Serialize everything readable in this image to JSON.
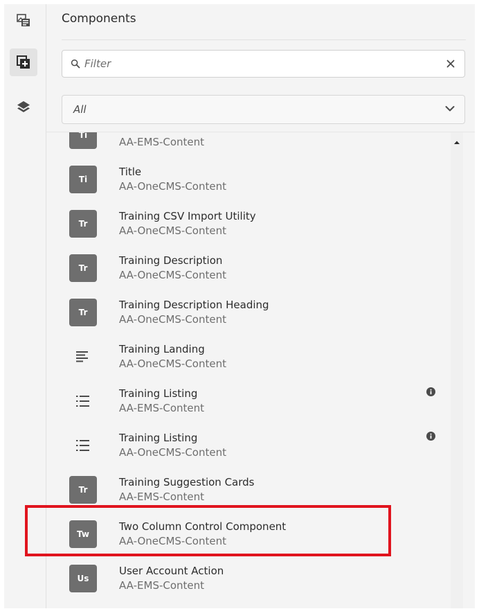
{
  "panel": {
    "title": "Components"
  },
  "filter": {
    "placeholder": "Filter",
    "value": ""
  },
  "group_select": {
    "value": "All"
  },
  "rail": {
    "buttons": [
      {
        "icon": "asset-finder-icon",
        "active": false
      },
      {
        "icon": "components-icon",
        "active": true
      },
      {
        "icon": "layers-icon",
        "active": false
      }
    ]
  },
  "components": [
    {
      "badge": "Ti",
      "name": "",
      "group": "AA-EMS-Content",
      "icon": "badge"
    },
    {
      "badge": "Ti",
      "name": "Title",
      "group": "AA-OneCMS-Content",
      "icon": "badge"
    },
    {
      "badge": "Tr",
      "name": "Training CSV Import Utility",
      "group": "AA-OneCMS-Content",
      "icon": "badge"
    },
    {
      "badge": "Tr",
      "name": "Training Description",
      "group": "AA-OneCMS-Content",
      "icon": "badge"
    },
    {
      "badge": "Tr",
      "name": "Training Description Heading",
      "group": "AA-OneCMS-Content",
      "icon": "badge"
    },
    {
      "badge": "",
      "name": "Training Landing",
      "group": "AA-OneCMS-Content",
      "icon": "text-align-icon"
    },
    {
      "badge": "",
      "name": "Training Listing",
      "group": "AA-EMS-Content",
      "icon": "bulleted-list-icon",
      "info": true
    },
    {
      "badge": "",
      "name": "Training Listing",
      "group": "AA-OneCMS-Content",
      "icon": "bulleted-list-icon",
      "info": true
    },
    {
      "badge": "Tr",
      "name": "Training Suggestion Cards",
      "group": "AA-EMS-Content",
      "icon": "badge"
    },
    {
      "badge": "Tw",
      "name": "Two Column Control Component",
      "group": "AA-OneCMS-Content",
      "icon": "badge",
      "highlighted": true
    },
    {
      "badge": "Us",
      "name": "User Account Action",
      "group": "AA-EMS-Content",
      "icon": "badge"
    }
  ],
  "colors": {
    "badge_bg": "#6e6e6e",
    "highlight": "#e0141e",
    "panel_bg": "#f4f4f4"
  }
}
